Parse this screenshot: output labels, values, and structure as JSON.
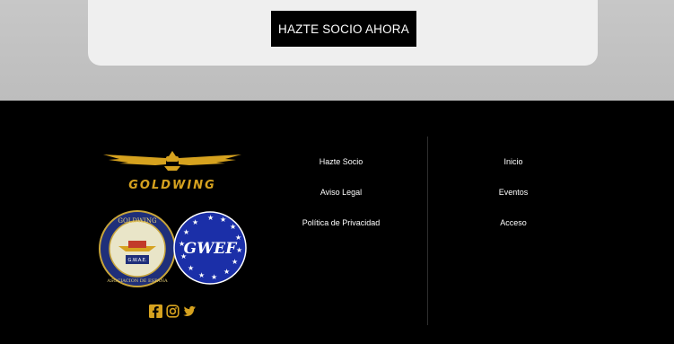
{
  "cta": {
    "label": "HAZTE SOCIO AHORA"
  },
  "brand": {
    "logo_text": "GOLDWING",
    "gold": "#d6a21f"
  },
  "badges": {
    "club_text_top": "GOLDWING",
    "club_text_bottom": "ASOCIACION DE ESPAÑA",
    "club_center": "G.W.A.E.",
    "gwef_text": "GWEF"
  },
  "nav_left": [
    {
      "label": "Hazte Socio"
    },
    {
      "label": "Aviso Legal"
    },
    {
      "label": "Política de Privacidad"
    }
  ],
  "nav_right": [
    {
      "label": "Inicio"
    },
    {
      "label": "Eventos"
    },
    {
      "label": "Acceso"
    }
  ],
  "social": [
    "facebook-icon",
    "instagram-icon",
    "twitter-icon"
  ]
}
